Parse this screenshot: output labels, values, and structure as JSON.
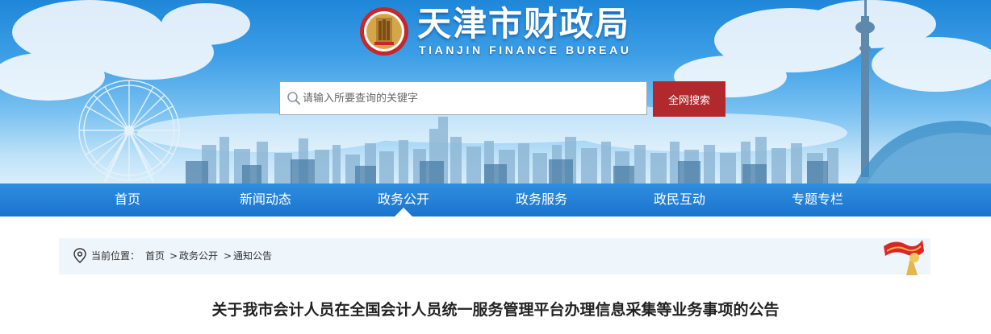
{
  "header": {
    "title": "天津市财政局",
    "subtitle": "TIANJIN FINANCE BUREAU",
    "logo_icon": "emblem-icon"
  },
  "search": {
    "placeholder": "请输入所要查询的关键字",
    "value": "",
    "button_label": "全网搜索"
  },
  "nav": {
    "items": [
      {
        "label": "首页"
      },
      {
        "label": "新闻动态"
      },
      {
        "label": "政务公开",
        "active": true
      },
      {
        "label": "政务服务"
      },
      {
        "label": "政民互动"
      },
      {
        "label": "专题专栏"
      }
    ]
  },
  "breadcrumb": {
    "label": "当前位置：",
    "items": [
      "首页",
      "政务公开",
      "通知公告"
    ],
    "separator": ">"
  },
  "article": {
    "title": "关于我市会计人员在全国会计人员统一服务管理平台办理信息采集等业务事项的公告"
  },
  "colors": {
    "accent_red": "#b1292c",
    "nav_blue": "#1a74cc",
    "crumb_bg": "#eef5fb"
  }
}
